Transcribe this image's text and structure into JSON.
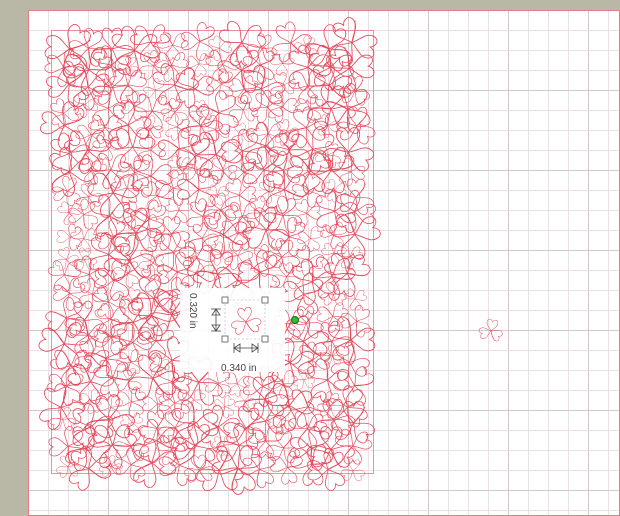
{
  "canvas": {
    "background_color": "#b9b7a6",
    "mat_color": "#ffffff",
    "grid_fine_color": "#ece0e4",
    "grid_major_color": "#d4c8cc",
    "border_color": "#e87a8a",
    "cut_line_color": "#e34a5c"
  },
  "selection": {
    "width_label": "0.340 in",
    "height_label": "0.320 in",
    "handle_color": "#555555",
    "rotate_handle_color": "#2fbf2f"
  },
  "shapes": {
    "stray_shape_icon": "shamrock-icon",
    "pattern_icon": "shamrock-icon"
  }
}
